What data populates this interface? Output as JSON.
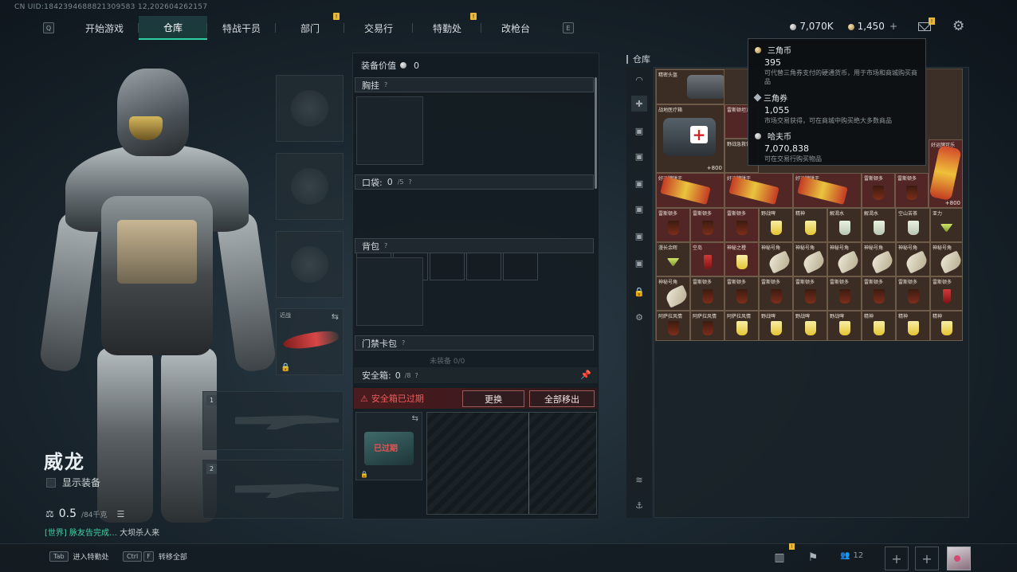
{
  "uid_line": "CN UID:1842394688821309583 12,202604262157",
  "nav": {
    "left_key": "Q",
    "right_key": "E",
    "tabs": [
      {
        "label": "开始游戏",
        "active": false,
        "badge": ""
      },
      {
        "label": "仓库",
        "active": true,
        "badge": ""
      },
      {
        "label": "特战干员",
        "active": false,
        "badge": ""
      },
      {
        "label": "部门",
        "active": false,
        "badge": "!"
      },
      {
        "label": "交易行",
        "active": false,
        "badge": ""
      },
      {
        "label": "特勤处",
        "active": false,
        "badge": "!"
      },
      {
        "label": "改枪台",
        "active": false,
        "badge": ""
      }
    ]
  },
  "currency": {
    "coins_value": "7,070K",
    "gold_value": "1,450",
    "plus": "+",
    "mail_badge": "!"
  },
  "operator": {
    "name": "威龙",
    "show_equipment_label": "显示装备",
    "weight_value": "0.5",
    "weight_max": "/84千克",
    "chat_channel": "[世界]",
    "chat_sender": " 脉友告完成…",
    "chat_text": " 大坝杀人来"
  },
  "slots": {
    "melee_label": "近战",
    "weapon1_num": "1",
    "weapon2_num": "2"
  },
  "gear": {
    "value_label": "装备价值",
    "value": "0",
    "chest_rig": "胸挂",
    "pockets_label": "口袋:",
    "pockets_value": "0",
    "pockets_max": "/5",
    "backpack": "背包",
    "keycard": "门禁卡包",
    "hint_text": "未装备 0/0",
    "safe_label": "安全箱:",
    "safe_value": "0",
    "safe_max": "/8",
    "alert": "安全箱已过期",
    "swap_btn": "更换",
    "move_all_btn": "全部移出",
    "case_expired": "已过期"
  },
  "warehouse": {
    "title": "仓库",
    "items": [
      {
        "label": "精密头盔",
        "count": ""
      },
      {
        "label": "战地医疗箱",
        "count": "+800"
      },
      {
        "label": "雷斯顿坦克",
        "count": ""
      },
      {
        "label": "野战急救包",
        "count": ""
      },
      {
        "label": "好运牌可乐",
        "count": "+800"
      },
      {
        "label": "好运牌饼干",
        "count": ""
      },
      {
        "label": "好运牌饼干",
        "count": ""
      },
      {
        "label": "好运牌饼干",
        "count": ""
      },
      {
        "label": "雷斯顿多",
        "count": ""
      },
      {
        "label": "雷斯顿多",
        "count": ""
      },
      {
        "label": "雷斯顿多",
        "count": ""
      },
      {
        "label": "雷斯顿多",
        "count": ""
      },
      {
        "label": "雷斯顿多",
        "count": ""
      },
      {
        "label": "野战啤",
        "count": ""
      },
      {
        "label": "精神",
        "count": ""
      },
      {
        "label": "解渴水",
        "count": ""
      },
      {
        "label": "解渴水",
        "count": ""
      },
      {
        "label": "空山苦茶",
        "count": ""
      },
      {
        "label": "亚力",
        "count": ""
      },
      {
        "label": "漫长余晖",
        "count": ""
      },
      {
        "label": "空岛",
        "count": ""
      },
      {
        "label": "神秘之橙",
        "count": ""
      },
      {
        "label": "神秘号角",
        "count": ""
      },
      {
        "label": "神秘号角",
        "count": ""
      },
      {
        "label": "神秘号角",
        "count": ""
      },
      {
        "label": "神秘号角",
        "count": ""
      },
      {
        "label": "神秘号角",
        "count": ""
      },
      {
        "label": "神秘号角",
        "count": ""
      },
      {
        "label": "雷斯顿多",
        "count": ""
      },
      {
        "label": "雷斯顿多",
        "count": ""
      },
      {
        "label": "雷斯顿多",
        "count": ""
      },
      {
        "label": "雷斯顿多",
        "count": ""
      },
      {
        "label": "雷斯顿多",
        "count": ""
      },
      {
        "label": "阿萨拉风情",
        "count": ""
      },
      {
        "label": "阿萨拉风情",
        "count": ""
      },
      {
        "label": "阿萨拉风情",
        "count": ""
      },
      {
        "label": "野战啤",
        "count": ""
      },
      {
        "label": "野战啤",
        "count": ""
      },
      {
        "label": "野战啤",
        "count": ""
      },
      {
        "label": "精神",
        "count": ""
      },
      {
        "label": "精神",
        "count": ""
      }
    ]
  },
  "tooltip": {
    "c1_name": "三角币",
    "c1_value": "395",
    "c1_desc": "可代替三角券支付的硬通货币，用于市场和商城购买商品",
    "c2_name": "三角券",
    "c2_value": "1,055",
    "c2_desc": "市场交易获得，可在商城中购买绝大多数商品",
    "c3_name": "哈夫币",
    "c3_value": "7,070,838",
    "c3_desc": "可在交易行购买物品"
  },
  "bottom": {
    "hotkey1_key": "Tab",
    "hotkey1_label": "进入特勤处",
    "hotkey2_key1": "Ctrl",
    "hotkey2_key2": "F",
    "hotkey2_label": "转移全部",
    "squad_count": "12",
    "stats_badge": "!"
  },
  "colors": {
    "accent": "#2fd0a6",
    "badge": "#e9b93b",
    "alert": "#ef5b5b"
  }
}
